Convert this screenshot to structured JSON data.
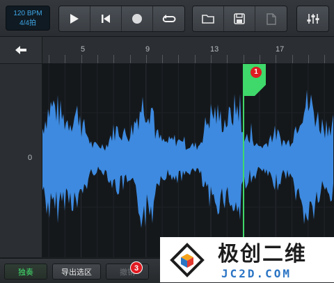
{
  "toolbar": {
    "tempo_bpm": "120 BPM",
    "time_signature": "4/4拍",
    "transport_buttons": [
      {
        "icon": "play-icon"
      },
      {
        "icon": "skip-to-start-icon"
      },
      {
        "icon": "record-icon"
      },
      {
        "icon": "loop-icon"
      }
    ],
    "file_buttons": [
      {
        "icon": "folder-icon"
      },
      {
        "icon": "save-icon"
      },
      {
        "icon": "new-file-icon"
      }
    ],
    "settings_button": {
      "icon": "mixer-sliders-icon"
    }
  },
  "ruler": {
    "back_icon": "back-arrow-icon",
    "bars": [
      "5",
      "9",
      "13",
      "17"
    ]
  },
  "track": {
    "zero_label": "0",
    "waveform_color": "#3d8ae0",
    "playhead_color": "#3fd86a",
    "marker_badge": "1"
  },
  "bottom_bar": {
    "solo_label": "独奏",
    "export_label": "导出选区",
    "undo_label": "撤销",
    "badge": "3"
  },
  "watermark": {
    "title_cn": "极创二维",
    "site": "JC2D.COM"
  }
}
